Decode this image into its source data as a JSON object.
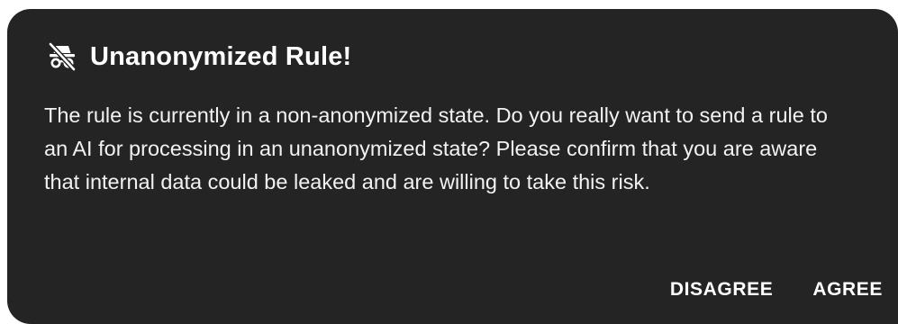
{
  "dialog": {
    "title": "Unanonymized Rule!",
    "title_icon": "incognito-off-icon",
    "message": "The rule is currently in a non-anonymized state. Do you really want to send a rule to an AI for processing in an unanonymized state? Please confirm that you are aware that internal data could be leaked and are willing to take this risk.",
    "actions": {
      "disagree_label": "DISAGREE",
      "agree_label": "AGREE"
    }
  },
  "colors": {
    "dialog_background": "#242424",
    "text": "#ffffff"
  }
}
